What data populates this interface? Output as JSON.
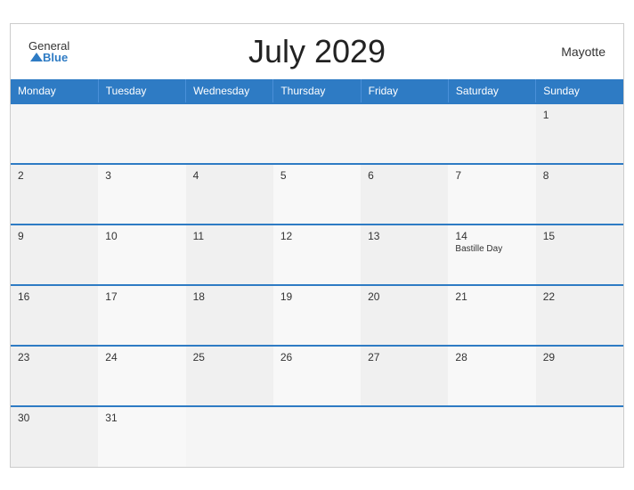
{
  "header": {
    "title": "July 2029",
    "location": "Mayotte",
    "logo": {
      "general": "General",
      "blue": "Blue"
    }
  },
  "weekdays": [
    "Monday",
    "Tuesday",
    "Wednesday",
    "Thursday",
    "Friday",
    "Saturday",
    "Sunday"
  ],
  "weeks": [
    [
      {
        "day": "",
        "event": ""
      },
      {
        "day": "",
        "event": ""
      },
      {
        "day": "",
        "event": ""
      },
      {
        "day": "",
        "event": ""
      },
      {
        "day": "",
        "event": ""
      },
      {
        "day": "",
        "event": ""
      },
      {
        "day": "1",
        "event": ""
      }
    ],
    [
      {
        "day": "2",
        "event": ""
      },
      {
        "day": "3",
        "event": ""
      },
      {
        "day": "4",
        "event": ""
      },
      {
        "day": "5",
        "event": ""
      },
      {
        "day": "6",
        "event": ""
      },
      {
        "day": "7",
        "event": ""
      },
      {
        "day": "8",
        "event": ""
      }
    ],
    [
      {
        "day": "9",
        "event": ""
      },
      {
        "day": "10",
        "event": ""
      },
      {
        "day": "11",
        "event": ""
      },
      {
        "day": "12",
        "event": ""
      },
      {
        "day": "13",
        "event": ""
      },
      {
        "day": "14",
        "event": "Bastille Day"
      },
      {
        "day": "15",
        "event": ""
      }
    ],
    [
      {
        "day": "16",
        "event": ""
      },
      {
        "day": "17",
        "event": ""
      },
      {
        "day": "18",
        "event": ""
      },
      {
        "day": "19",
        "event": ""
      },
      {
        "day": "20",
        "event": ""
      },
      {
        "day": "21",
        "event": ""
      },
      {
        "day": "22",
        "event": ""
      }
    ],
    [
      {
        "day": "23",
        "event": ""
      },
      {
        "day": "24",
        "event": ""
      },
      {
        "day": "25",
        "event": ""
      },
      {
        "day": "26",
        "event": ""
      },
      {
        "day": "27",
        "event": ""
      },
      {
        "day": "28",
        "event": ""
      },
      {
        "day": "29",
        "event": ""
      }
    ],
    [
      {
        "day": "30",
        "event": ""
      },
      {
        "day": "31",
        "event": ""
      },
      {
        "day": "",
        "event": ""
      },
      {
        "day": "",
        "event": ""
      },
      {
        "day": "",
        "event": ""
      },
      {
        "day": "",
        "event": ""
      },
      {
        "day": "",
        "event": ""
      }
    ]
  ]
}
